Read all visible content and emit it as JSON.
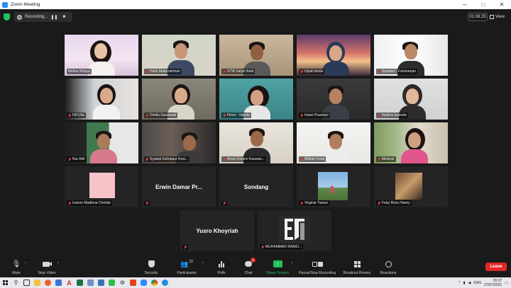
{
  "window": {
    "title": "Zoom Meeting",
    "minimize": "─",
    "maximize": "□",
    "close": "✕"
  },
  "recording": {
    "label": "Recording...",
    "pause": "❚❚",
    "stop": "■"
  },
  "timer": "01:08:25",
  "view_label": "View",
  "participants": [
    {
      "name": "Melisa Wijaya",
      "muted": false
    },
    {
      "name": "Hafiz Abdurrahman",
      "muted": true
    },
    {
      "name": "STW Zalyin Batti",
      "muted": true
    },
    {
      "name": "Ulyah Aziza",
      "muted": true
    },
    {
      "name": "Speaker - Fanstampu",
      "muted": true
    },
    {
      "name": "Fifi Ulia",
      "muted": true
    },
    {
      "name": "Dimlia Saraswati",
      "muted": true
    },
    {
      "name": "Fimer - Nanda",
      "muted": true
    },
    {
      "name": "Imam Prasetyo",
      "muted": true
    },
    {
      "name": "Nadina Isamete",
      "muted": true
    },
    {
      "name": "Nur Adil",
      "muted": true
    },
    {
      "name": "Syawal Zulmaqur Kow...",
      "muted": true
    },
    {
      "name": "Alvan Dolami Kaseaw...",
      "muted": true
    },
    {
      "name": "Mifttah Huda",
      "muted": true
    },
    {
      "name": "Melanie",
      "muted": true
    },
    {
      "name": "Ivanne Madlena Christie",
      "muted": true
    },
    {
      "name": "Erwin Damar Pr...",
      "muted": true
    },
    {
      "name": "Sondang",
      "muted": true
    },
    {
      "name": "Virginia Tiarasi",
      "muted": true
    },
    {
      "name": "Feby Ristu Hanny",
      "muted": true
    },
    {
      "name": "Yusro Khoyriah",
      "muted": true
    },
    {
      "name": "MUHAMMAD RAMZI...",
      "muted": true
    }
  ],
  "center_names": {
    "erwin": "Erwin Damar Pr...",
    "sondang": "Sondang",
    "yusro": "Yusro Khoyriah"
  },
  "toolbar": {
    "mute": "Mute",
    "stop_video": "Stop Video",
    "security": "Security",
    "participants": "Participants",
    "participants_count": "22",
    "polls": "Polls",
    "chat": "Chat",
    "chat_badge": "3",
    "share_screen": "Share Screen",
    "pause_recording": "Pause/Stop Recording",
    "breakout_rooms": "Breakout Rooms",
    "reactions": "Reactions",
    "leave": "Leave"
  },
  "taskbar": {
    "lang": "ENG",
    "time": "20:37",
    "date": "27/07/2021"
  },
  "colors": {
    "active_speaker": "#c8d838",
    "leave": "#e02828",
    "share": "#23c25b"
  }
}
